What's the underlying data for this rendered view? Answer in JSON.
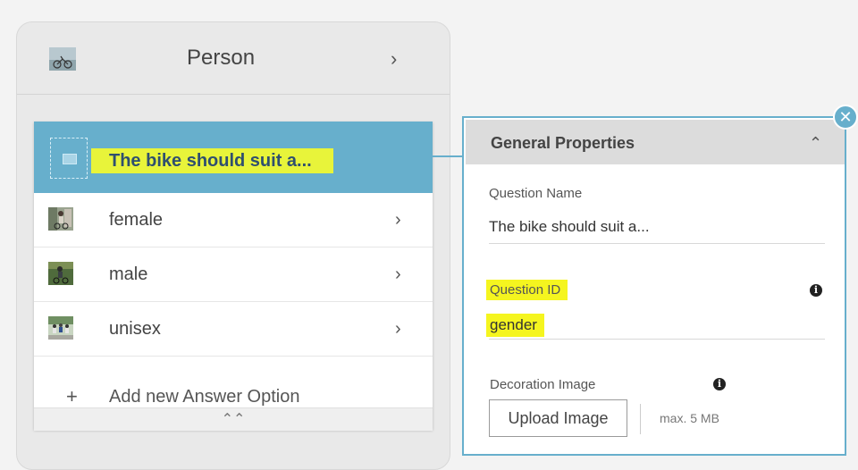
{
  "category": {
    "title": "Person",
    "thumbnail_icon": "bike-photo-icon"
  },
  "question": {
    "title": "The bike should suit a...",
    "placeholder_icon": "image-placeholder-icon"
  },
  "options": [
    {
      "label": "female",
      "thumbnail_icon": "female-cyclist-photo-icon"
    },
    {
      "label": "male",
      "thumbnail_icon": "male-cyclist-photo-icon"
    },
    {
      "label": "unisex",
      "thumbnail_icon": "group-cyclists-photo-icon"
    }
  ],
  "add_option_label": "Add new Answer Option",
  "properties": {
    "panel_title": "General Properties",
    "question_name_label": "Question Name",
    "question_name_value": "The bike should suit a...",
    "question_id_label": "Question ID",
    "question_id_value": "gender",
    "decoration_label": "Decoration Image",
    "upload_label": "Upload Image",
    "upload_hint": "max. 5 MB"
  },
  "colors": {
    "accent": "#67afcc",
    "highlight": "#e8f43a"
  }
}
